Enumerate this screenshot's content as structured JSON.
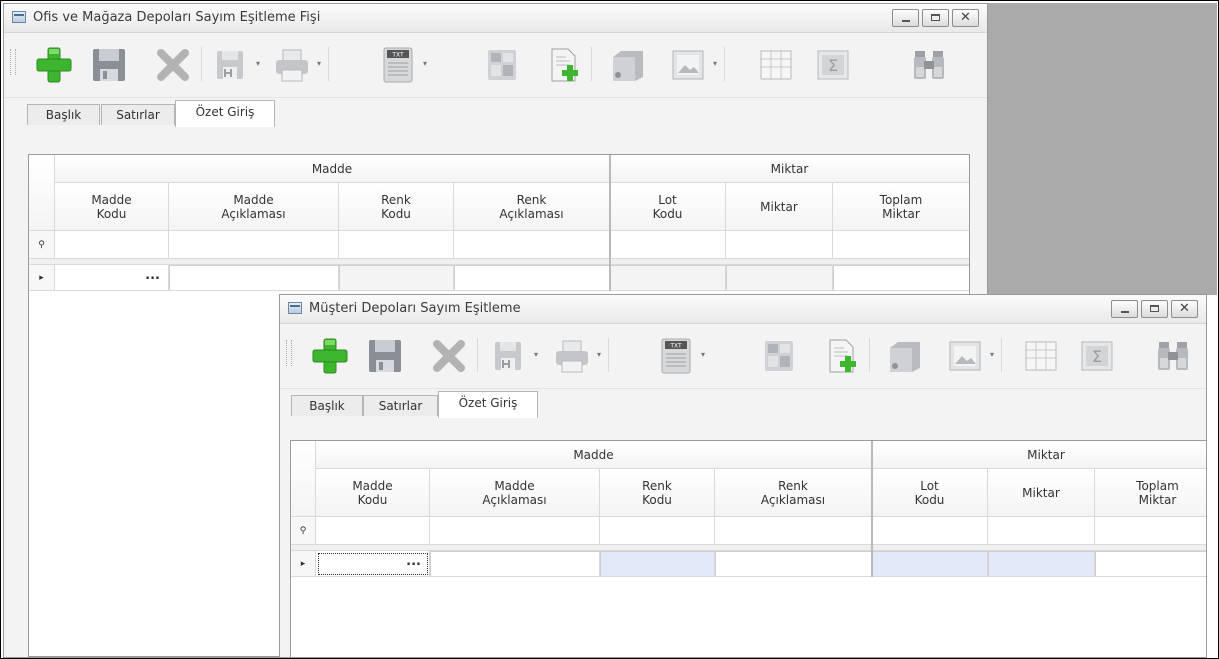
{
  "window1": {
    "title": "Ofis ve Mağaza Depoları Sayım Eşitleme Fişi",
    "tabs": [
      {
        "label": "Başlık",
        "active": false
      },
      {
        "label": "Satırlar",
        "active": false
      },
      {
        "label": "Özet Giriş",
        "active": true
      }
    ],
    "band_groups": [
      "Madde",
      "Miktar"
    ],
    "columns": [
      "Madde\nKodu",
      "Madde\nAçıklaması",
      "Renk\nKodu",
      "Renk\nAçıklaması",
      "Lot\nKodu",
      "Miktar",
      "Toplam\nMiktar"
    ],
    "new_row_ellipsis": "..."
  },
  "window2": {
    "title": "Müşteri Depoları Sayım Eşitleme",
    "tabs": [
      {
        "label": "Başlık",
        "active": false
      },
      {
        "label": "Satırlar",
        "active": false
      },
      {
        "label": "Özet Giriş",
        "active": true
      }
    ],
    "band_groups": [
      "Madde",
      "Miktar"
    ],
    "columns": [
      "Madde\nKodu",
      "Madde\nAçıklaması",
      "Renk\nKodu",
      "Renk\nAçıklaması",
      "Lot\nKodu",
      "Miktar",
      "Toplam\nMiktar"
    ],
    "new_row_ellipsis": "..."
  },
  "toolbar_icons": [
    "add-icon",
    "save-icon",
    "delete-icon",
    "save-as-icon",
    "print-icon",
    "txt-export-icon",
    "calculator-icon",
    "new-document-icon",
    "archive-box-icon",
    "image-icon",
    "table-layout-icon",
    "sum-icon",
    "binoculars-icon"
  ],
  "colors": {
    "desktop": "#aaaaaa",
    "window_bg": "#f3f3f3",
    "add_green": "#3eb52e",
    "save_gray": "#8a8f96",
    "delete_gray": "#b3b3b3",
    "selected_cell": "#e3e9f9",
    "focus_dotted": "#333333"
  }
}
